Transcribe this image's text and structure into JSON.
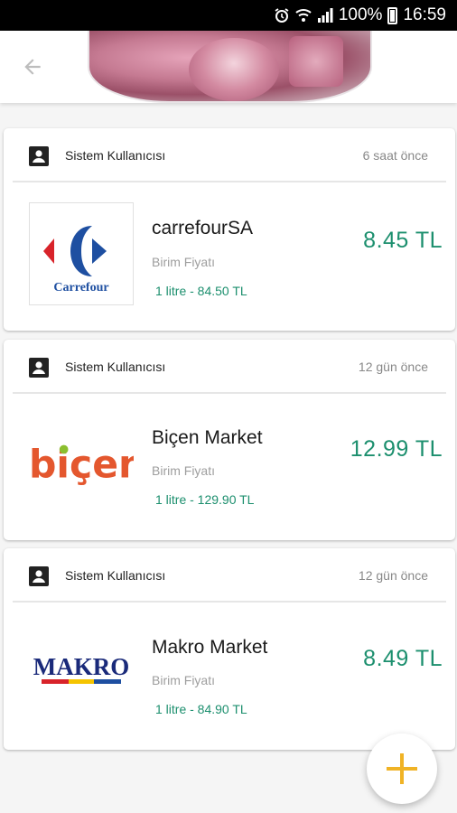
{
  "status_bar": {
    "battery": "100%",
    "time": "16:59",
    "icons": [
      "alarm-icon",
      "wifi-icon",
      "signal-icon",
      "battery-icon"
    ]
  },
  "header": {
    "back_icon": "arrow-left-icon",
    "product_image": "ice-cream-product-photo"
  },
  "colors": {
    "accent": "#1c8f6e",
    "fab_plus": "#f0b325",
    "muted": "#9e9e9e"
  },
  "offers": [
    {
      "user": "Sistem Kullanıcısı",
      "time_ago": "6 saat önce",
      "store_logo": "carrefour",
      "logo_text": "Carrefour",
      "market": "carrefourSA",
      "unit_label": "Birim Fiyatı",
      "unit_price": "1 litre - 84.50 TL",
      "price": "8.45 TL"
    },
    {
      "user": "Sistem Kullanıcısı",
      "time_ago": "12 gün önce",
      "store_logo": "bicen",
      "logo_text": "biçen",
      "market": "Biçen Market",
      "unit_label": "Birim Fiyatı",
      "unit_price": "1 litre - 129.90 TL",
      "price": "12.99 TL"
    },
    {
      "user": "Sistem Kullanıcısı",
      "time_ago": "12 gün önce",
      "store_logo": "makro",
      "logo_text": "MAKRO",
      "market": "Makro Market",
      "unit_label": "Birim Fiyatı",
      "unit_price": "1 litre - 84.90 TL",
      "price": "8.49 TL"
    }
  ],
  "fab": {
    "icon": "plus-icon"
  }
}
